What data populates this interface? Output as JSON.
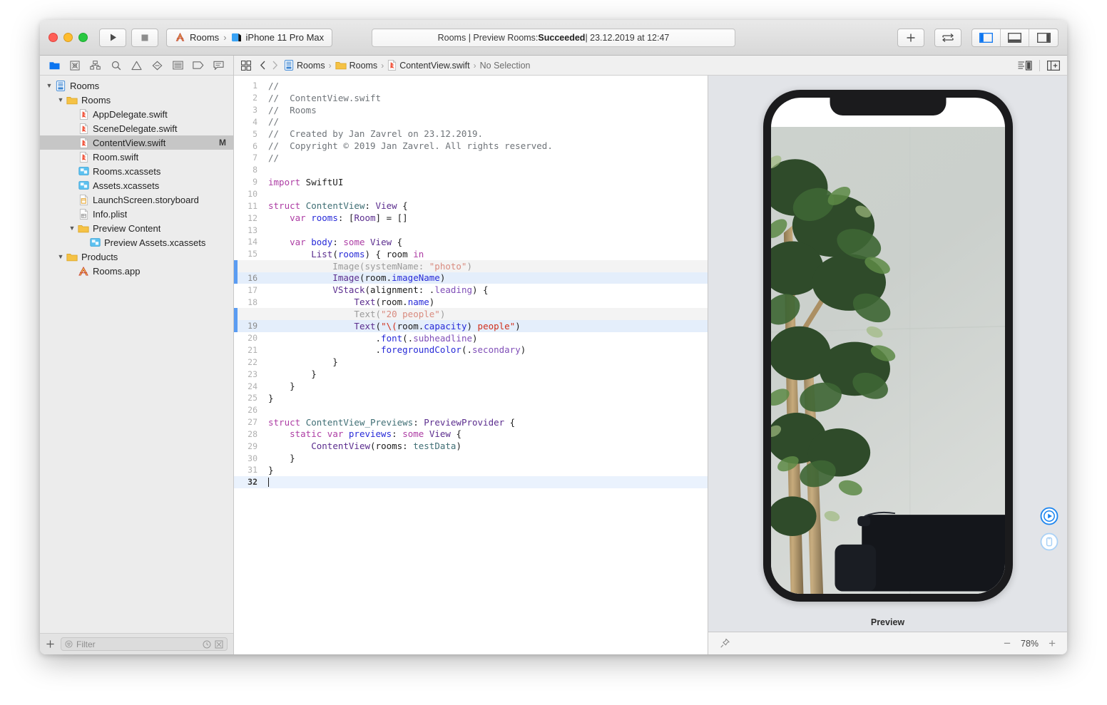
{
  "window": {
    "traffic_lights": [
      "close",
      "minimize",
      "zoom"
    ]
  },
  "toolbar": {
    "run_label": "Run",
    "stop_label": "Stop",
    "scheme_project": "Rooms",
    "scheme_separator": "›",
    "scheme_destination": "iPhone 11 Pro Max",
    "status_prefix": "Rooms | Preview Rooms: ",
    "status_result": "Succeeded",
    "status_suffix": " | 23.12.2019 at 12:47",
    "add_label": "+",
    "icons": {
      "run": "play-icon",
      "stop": "stop-icon",
      "scheme_app": "xcode-app-icon",
      "scheme_device": "simulator-icon",
      "add": "plus-icon",
      "swap": "swap-arrows-icon",
      "nav_panel": "left-panel-toggle-icon",
      "debug_panel": "bottom-panel-toggle-icon",
      "inspector_panel": "right-panel-toggle-icon"
    }
  },
  "navigator": {
    "tabs": [
      {
        "name": "project-navigator",
        "icon": "folder-icon",
        "active": true
      },
      {
        "name": "source-control-navigator",
        "icon": "source-control-icon",
        "active": false
      },
      {
        "name": "symbol-navigator",
        "icon": "hierarchy-icon",
        "active": false
      },
      {
        "name": "find-navigator",
        "icon": "search-icon",
        "active": false
      },
      {
        "name": "issue-navigator",
        "icon": "warning-triangle-icon",
        "active": false
      },
      {
        "name": "test-navigator",
        "icon": "diamond-icon",
        "active": false
      },
      {
        "name": "debug-navigator",
        "icon": "list-icon",
        "active": false
      },
      {
        "name": "breakpoint-navigator",
        "icon": "tag-icon",
        "active": false
      },
      {
        "name": "report-navigator",
        "icon": "speech-bubble-icon",
        "active": false
      }
    ],
    "tree": [
      {
        "label": "Rooms",
        "depth": 0,
        "icon": "project-icon",
        "twisty": "down",
        "selected": false,
        "badge": ""
      },
      {
        "label": "Rooms",
        "depth": 1,
        "icon": "folder-icon",
        "twisty": "down",
        "selected": false,
        "badge": ""
      },
      {
        "label": "AppDelegate.swift",
        "depth": 2,
        "icon": "swift-file-icon",
        "twisty": "",
        "selected": false,
        "badge": ""
      },
      {
        "label": "SceneDelegate.swift",
        "depth": 2,
        "icon": "swift-file-icon",
        "twisty": "",
        "selected": false,
        "badge": ""
      },
      {
        "label": "ContentView.swift",
        "depth": 2,
        "icon": "swift-file-icon",
        "twisty": "",
        "selected": true,
        "badge": "M"
      },
      {
        "label": "Room.swift",
        "depth": 2,
        "icon": "swift-file-icon",
        "twisty": "",
        "selected": false,
        "badge": ""
      },
      {
        "label": "Rooms.xcassets",
        "depth": 2,
        "icon": "assets-icon",
        "twisty": "",
        "selected": false,
        "badge": ""
      },
      {
        "label": "Assets.xcassets",
        "depth": 2,
        "icon": "assets-icon",
        "twisty": "",
        "selected": false,
        "badge": ""
      },
      {
        "label": "LaunchScreen.storyboard",
        "depth": 2,
        "icon": "storyboard-icon",
        "twisty": "",
        "selected": false,
        "badge": ""
      },
      {
        "label": "Info.plist",
        "depth": 2,
        "icon": "plist-icon",
        "twisty": "",
        "selected": false,
        "badge": ""
      },
      {
        "label": "Preview Content",
        "depth": 2,
        "icon": "folder-icon",
        "twisty": "down",
        "selected": false,
        "badge": ""
      },
      {
        "label": "Preview Assets.xcassets",
        "depth": 3,
        "icon": "assets-icon",
        "twisty": "",
        "selected": false,
        "badge": ""
      },
      {
        "label": "Products",
        "depth": 1,
        "icon": "folder-icon",
        "twisty": "down",
        "selected": false,
        "badge": ""
      },
      {
        "label": "Rooms.app",
        "depth": 2,
        "icon": "app-icon",
        "twisty": "",
        "selected": false,
        "badge": ""
      }
    ],
    "filter": {
      "placeholder": "Filter",
      "add_label": "+",
      "icons": [
        "filter-icon",
        "recent-clock-icon",
        "source-control-filter-icon"
      ]
    }
  },
  "jumpbar": {
    "grid_icon": "related-items-icon",
    "back_icon": "chevron-left-icon",
    "forward_icon": "chevron-right-icon",
    "crumbs": [
      {
        "label": "Rooms",
        "icon": "project-icon"
      },
      {
        "label": "Rooms",
        "icon": "folder-icon"
      },
      {
        "label": "ContentView.swift",
        "icon": "swift-file-icon"
      },
      {
        "label": "No Selection",
        "icon": ""
      }
    ],
    "separator": "›",
    "right_icons": [
      "editor-options-icon",
      "add-editor-icon"
    ]
  },
  "code": {
    "lines": [
      {
        "num": "1",
        "state": "",
        "tokens": [
          {
            "t": "c",
            "v": "//"
          }
        ]
      },
      {
        "num": "2",
        "state": "",
        "tokens": [
          {
            "t": "c",
            "v": "//  ContentView.swift"
          }
        ]
      },
      {
        "num": "3",
        "state": "",
        "tokens": [
          {
            "t": "c",
            "v": "//  Rooms"
          }
        ]
      },
      {
        "num": "4",
        "state": "",
        "tokens": [
          {
            "t": "c",
            "v": "//"
          }
        ]
      },
      {
        "num": "5",
        "state": "",
        "tokens": [
          {
            "t": "c",
            "v": "//  Created by Jan Zavrel on 23.12.2019."
          }
        ]
      },
      {
        "num": "6",
        "state": "",
        "tokens": [
          {
            "t": "c",
            "v": "//  Copyright © 2019 Jan Zavrel. All rights reserved."
          }
        ]
      },
      {
        "num": "7",
        "state": "",
        "tokens": [
          {
            "t": "c",
            "v": "//"
          }
        ]
      },
      {
        "num": "8",
        "state": "",
        "tokens": []
      },
      {
        "num": "9",
        "state": "",
        "tokens": [
          {
            "t": "k",
            "v": "import"
          },
          {
            "t": "pl",
            "v": " SwiftUI"
          }
        ]
      },
      {
        "num": "10",
        "state": "",
        "tokens": []
      },
      {
        "num": "11",
        "state": "",
        "tokens": [
          {
            "t": "k",
            "v": "struct"
          },
          {
            "t": "pl",
            "v": " "
          },
          {
            "t": "t",
            "v": "ContentView"
          },
          {
            "t": "pl",
            "v": ": "
          },
          {
            "t": "ty",
            "v": "View"
          },
          {
            "t": "pl",
            "v": " {"
          }
        ]
      },
      {
        "num": "12",
        "state": "",
        "tokens": [
          {
            "t": "pl",
            "v": "    "
          },
          {
            "t": "k",
            "v": "var"
          },
          {
            "t": "pl",
            "v": " "
          },
          {
            "t": "p",
            "v": "rooms"
          },
          {
            "t": "pl",
            "v": ": ["
          },
          {
            "t": "ty",
            "v": "Room"
          },
          {
            "t": "pl",
            "v": "] = []"
          }
        ]
      },
      {
        "num": "13",
        "state": "",
        "tokens": []
      },
      {
        "num": "14",
        "state": "",
        "tokens": [
          {
            "t": "pl",
            "v": "    "
          },
          {
            "t": "k",
            "v": "var"
          },
          {
            "t": "pl",
            "v": " "
          },
          {
            "t": "p",
            "v": "body"
          },
          {
            "t": "pl",
            "v": ": "
          },
          {
            "t": "k",
            "v": "some"
          },
          {
            "t": "pl",
            "v": " "
          },
          {
            "t": "ty",
            "v": "View"
          },
          {
            "t": "pl",
            "v": " {"
          }
        ]
      },
      {
        "num": "15",
        "state": "",
        "tokens": [
          {
            "t": "pl",
            "v": "        "
          },
          {
            "t": "ty",
            "v": "List"
          },
          {
            "t": "pl",
            "v": "("
          },
          {
            "t": "p",
            "v": "rooms"
          },
          {
            "t": "pl",
            "v": ") { room "
          },
          {
            "t": "k",
            "v": "in"
          }
        ]
      },
      {
        "num": "",
        "state": "removed",
        "tokens": [
          {
            "t": "pl",
            "v": "            Image(systemName: "
          },
          {
            "t": "s",
            "v": "\"photo\""
          },
          {
            "t": "pl",
            "v": ")"
          }
        ]
      },
      {
        "num": "16",
        "state": "added",
        "tokens": [
          {
            "t": "ty",
            "v": "            Image"
          },
          {
            "t": "pl",
            "v": "(room."
          },
          {
            "t": "p",
            "v": "imageName"
          },
          {
            "t": "pl",
            "v": ")"
          }
        ]
      },
      {
        "num": "17",
        "state": "",
        "tokens": [
          {
            "t": "pl",
            "v": "            "
          },
          {
            "t": "ty",
            "v": "VStack"
          },
          {
            "t": "pl",
            "v": "(alignment: ."
          },
          {
            "t": "m",
            "v": "leading"
          },
          {
            "t": "pl",
            "v": ") {"
          }
        ]
      },
      {
        "num": "18",
        "state": "",
        "tokens": [
          {
            "t": "pl",
            "v": "                "
          },
          {
            "t": "ty",
            "v": "Text"
          },
          {
            "t": "pl",
            "v": "(room."
          },
          {
            "t": "p",
            "v": "name"
          },
          {
            "t": "pl",
            "v": ")"
          }
        ]
      },
      {
        "num": "",
        "state": "removed",
        "tokens": [
          {
            "t": "pl",
            "v": "                Text("
          },
          {
            "t": "s",
            "v": "\"20 people\""
          },
          {
            "t": "pl",
            "v": ")"
          }
        ]
      },
      {
        "num": "19",
        "state": "added",
        "tokens": [
          {
            "t": "pl",
            "v": "                "
          },
          {
            "t": "ty",
            "v": "Text"
          },
          {
            "t": "pl",
            "v": "("
          },
          {
            "t": "s",
            "v": "\"\\("
          },
          {
            "t": "pl",
            "v": "room."
          },
          {
            "t": "p",
            "v": "capacity"
          },
          {
            "t": "pl",
            "v": ")"
          },
          {
            "t": "s",
            "v": " people\""
          },
          {
            "t": "pl",
            "v": ")"
          }
        ]
      },
      {
        "num": "20",
        "state": "",
        "tokens": [
          {
            "t": "pl",
            "v": "                    ."
          },
          {
            "t": "p",
            "v": "font"
          },
          {
            "t": "pl",
            "v": "(."
          },
          {
            "t": "m",
            "v": "subheadline"
          },
          {
            "t": "pl",
            "v": ")"
          }
        ]
      },
      {
        "num": "21",
        "state": "",
        "tokens": [
          {
            "t": "pl",
            "v": "                    ."
          },
          {
            "t": "p",
            "v": "foregroundColor"
          },
          {
            "t": "pl",
            "v": "(."
          },
          {
            "t": "m",
            "v": "secondary"
          },
          {
            "t": "pl",
            "v": ")"
          }
        ]
      },
      {
        "num": "22",
        "state": "",
        "tokens": [
          {
            "t": "pl",
            "v": "            }"
          }
        ]
      },
      {
        "num": "23",
        "state": "",
        "tokens": [
          {
            "t": "pl",
            "v": "        }"
          }
        ]
      },
      {
        "num": "24",
        "state": "",
        "tokens": [
          {
            "t": "pl",
            "v": "    }"
          }
        ]
      },
      {
        "num": "25",
        "state": "",
        "tokens": [
          {
            "t": "pl",
            "v": "}"
          }
        ]
      },
      {
        "num": "26",
        "state": "",
        "tokens": []
      },
      {
        "num": "27",
        "state": "",
        "tokens": [
          {
            "t": "k",
            "v": "struct"
          },
          {
            "t": "pl",
            "v": " "
          },
          {
            "t": "t",
            "v": "ContentView_Previews"
          },
          {
            "t": "pl",
            "v": ": "
          },
          {
            "t": "ty",
            "v": "PreviewProvider"
          },
          {
            "t": "pl",
            "v": " {"
          }
        ]
      },
      {
        "num": "28",
        "state": "",
        "tokens": [
          {
            "t": "pl",
            "v": "    "
          },
          {
            "t": "k",
            "v": "static"
          },
          {
            "t": "pl",
            "v": " "
          },
          {
            "t": "k",
            "v": "var"
          },
          {
            "t": "pl",
            "v": " "
          },
          {
            "t": "p",
            "v": "previews"
          },
          {
            "t": "pl",
            "v": ": "
          },
          {
            "t": "k",
            "v": "some"
          },
          {
            "t": "pl",
            "v": " "
          },
          {
            "t": "ty",
            "v": "View"
          },
          {
            "t": "pl",
            "v": " {"
          }
        ]
      },
      {
        "num": "29",
        "state": "",
        "tokens": [
          {
            "t": "pl",
            "v": "        "
          },
          {
            "t": "ty",
            "v": "ContentView"
          },
          {
            "t": "pl",
            "v": "(rooms: "
          },
          {
            "t": "t",
            "v": "testData"
          },
          {
            "t": "pl",
            "v": ")"
          }
        ]
      },
      {
        "num": "30",
        "state": "",
        "tokens": [
          {
            "t": "pl",
            "v": "    }"
          }
        ]
      },
      {
        "num": "31",
        "state": "",
        "tokens": [
          {
            "t": "pl",
            "v": "}"
          }
        ]
      },
      {
        "num": "32",
        "state": "caret",
        "tokens": []
      }
    ]
  },
  "preview": {
    "label": "Preview",
    "zoom_level": "78%",
    "zoom_out_label": "−",
    "zoom_in_label": "+",
    "pin_icon": "pin-icon",
    "live_preview_icon": "play-circle-icon",
    "preview_on_device_icon": "device-circle-icon",
    "device_name": "iPhone 11 Pro Max",
    "content_description": "Photo of a green potted tree next to a dark sofa against a light gray wall"
  },
  "colors": {
    "accent_blue": "#0a74f0",
    "change_bar": "#5a9cf2",
    "added_line_bg": "#e4eefb",
    "removed_line_bg": "#f3f3f3",
    "canvas_bg": "#e2e4e8",
    "navigator_bg": "#ececec",
    "selection_bg": "#c6c6c6"
  }
}
